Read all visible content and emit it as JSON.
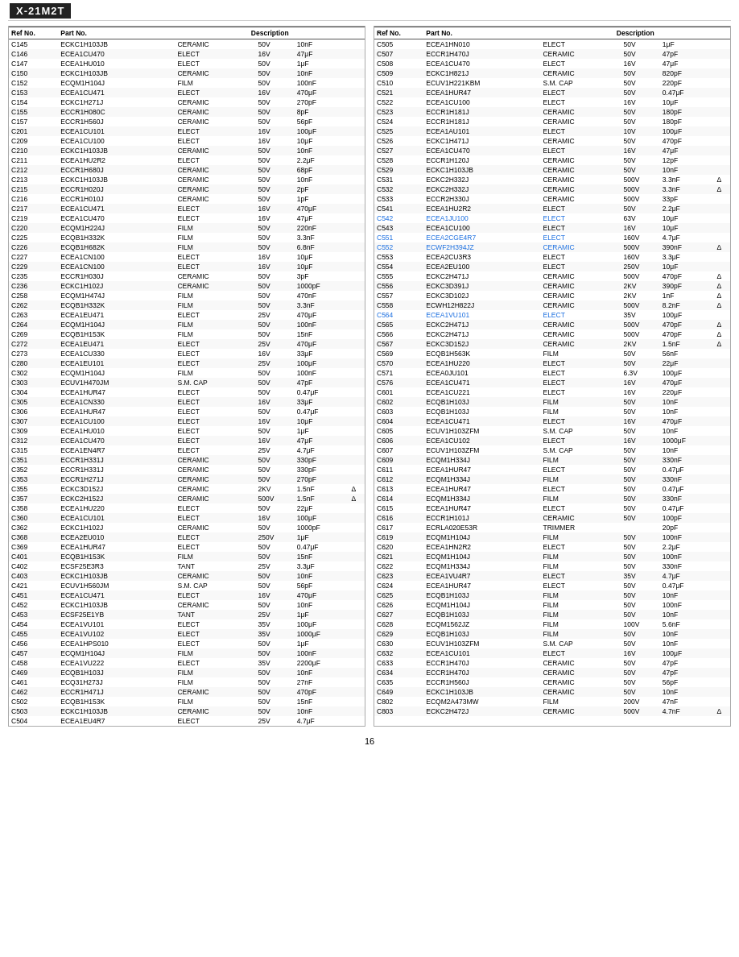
{
  "header": {
    "title": "X-21M2T"
  },
  "footer": {
    "page": "16"
  },
  "left_table": {
    "columns": [
      "Ref No.",
      "Part No.",
      "Description",
      "",
      "",
      ""
    ],
    "rows": [
      [
        "C145",
        "ECKC1H103JB",
        "CERAMIC",
        "50V",
        "10nF",
        ""
      ],
      [
        "C146",
        "ECEA1CU470",
        "ELECT",
        "16V",
        "47μF",
        ""
      ],
      [
        "C147",
        "ECEA1HU010",
        "ELECT",
        "50V",
        "1μF",
        ""
      ],
      [
        "C150",
        "ECKC1H103JB",
        "CERAMIC",
        "50V",
        "10nF",
        ""
      ],
      [
        "C152",
        "ECQM1H104J",
        "FILM",
        "50V",
        "100nF",
        ""
      ],
      [
        "C153",
        "ECEA1CU471",
        "ELECT",
        "16V",
        "470μF",
        ""
      ],
      [
        "C154",
        "ECKC1H271J",
        "CERAMIC",
        "50V",
        "270pF",
        ""
      ],
      [
        "C155",
        "ECCR1H080C",
        "CERAMIC",
        "50V",
        "8pF",
        ""
      ],
      [
        "C157",
        "ECCR1H560J",
        "CERAMIC",
        "50V",
        "56pF",
        ""
      ],
      [
        "C201",
        "ECEA1CU101",
        "ELECT",
        "16V",
        "100μF",
        ""
      ],
      [
        "C209",
        "ECEA1CU100",
        "ELECT",
        "16V",
        "10μF",
        ""
      ],
      [
        "C210",
        "ECKC1H103JB",
        "CERAMIC",
        "50V",
        "10nF",
        ""
      ],
      [
        "C211",
        "ECEA1HU2R2",
        "ELECT",
        "50V",
        "2.2μF",
        ""
      ],
      [
        "C212",
        "ECCR1H680J",
        "CERAMIC",
        "50V",
        "68pF",
        ""
      ],
      [
        "C213",
        "ECKC1H103JB",
        "CERAMIC",
        "50V",
        "10nF",
        ""
      ],
      [
        "C215",
        "ECCR1H020J",
        "CERAMIC",
        "50V",
        "2pF",
        ""
      ],
      [
        "C216",
        "ECCR1H010J",
        "CERAMIC",
        "50V",
        "1pF",
        ""
      ],
      [
        "C217",
        "ECEA1CU471",
        "ELECT",
        "16V",
        "470μF",
        ""
      ],
      [
        "C219",
        "ECEA1CU470",
        "ELECT",
        "16V",
        "47μF",
        ""
      ],
      [
        "C220",
        "ECQM1H224J",
        "FILM",
        "50V",
        "220nF",
        ""
      ],
      [
        "C225",
        "ECQB1H332K",
        "FILM",
        "50V",
        "3.3nF",
        ""
      ],
      [
        "C226",
        "ECQB1H682K",
        "FILM",
        "50V",
        "6.8nF",
        ""
      ],
      [
        "C227",
        "ECEA1CN100",
        "ELECT",
        "16V",
        "10μF",
        ""
      ],
      [
        "C229",
        "ECEA1CN100",
        "ELECT",
        "16V",
        "10μF",
        ""
      ],
      [
        "C235",
        "ECCR1H030J",
        "CERAMIC",
        "50V",
        "3pF",
        ""
      ],
      [
        "C236",
        "ECKC1H102J",
        "CERAMIC",
        "50V",
        "1000pF",
        ""
      ],
      [
        "C258",
        "ECQM1H474J",
        "FILM",
        "50V",
        "470nF",
        ""
      ],
      [
        "C262",
        "ECQB1H332K",
        "FILM",
        "50V",
        "3.3nF",
        ""
      ],
      [
        "C263",
        "ECEA1EU471",
        "ELECT",
        "25V",
        "470μF",
        ""
      ],
      [
        "C264",
        "ECQM1H104J",
        "FILM",
        "50V",
        "100nF",
        ""
      ],
      [
        "C269",
        "ECQB1H153K",
        "FILM",
        "50V",
        "15nF",
        ""
      ],
      [
        "C272",
        "ECEA1EU471",
        "ELECT",
        "25V",
        "470μF",
        ""
      ],
      [
        "C273",
        "ECEA1CU330",
        "ELECT",
        "16V",
        "33μF",
        ""
      ],
      [
        "C280",
        "ECEA1EU101",
        "ELECT",
        "25V",
        "100μF",
        ""
      ],
      [
        "C302",
        "ECQM1H104J",
        "FILM",
        "50V",
        "100nF",
        ""
      ],
      [
        "C303",
        "ECUV1H470JM",
        "S.M. CAP",
        "50V",
        "47pF",
        ""
      ],
      [
        "C304",
        "ECEA1HUR47",
        "ELECT",
        "50V",
        "0.47μF",
        ""
      ],
      [
        "C305",
        "ECEA1CN330",
        "ELECT",
        "16V",
        "33μF",
        ""
      ],
      [
        "C306",
        "ECEA1HUR47",
        "ELECT",
        "50V",
        "0.47μF",
        ""
      ],
      [
        "C307",
        "ECEA1CU100",
        "ELECT",
        "16V",
        "10μF",
        ""
      ],
      [
        "C309",
        "ECEA1HU010",
        "ELECT",
        "50V",
        "1μF",
        ""
      ],
      [
        "C312",
        "ECEA1CU470",
        "ELECT",
        "16V",
        "47μF",
        ""
      ],
      [
        "C315",
        "ECEA1EN4R7",
        "ELECT",
        "25V",
        "4.7μF",
        ""
      ],
      [
        "C351",
        "ECCR1H331J",
        "CERAMIC",
        "50V",
        "330pF",
        ""
      ],
      [
        "C352",
        "ECCR1H331J",
        "CERAMIC",
        "50V",
        "330pF",
        ""
      ],
      [
        "C353",
        "ECCR1H271J",
        "CERAMIC",
        "50V",
        "270pF",
        ""
      ],
      [
        "C355",
        "ECKC3D152J",
        "CERAMIC",
        "2KV",
        "1.5nF",
        "Δ"
      ],
      [
        "C357",
        "ECKC2H152J",
        "CERAMIC",
        "500V",
        "1.5nF",
        "Δ"
      ],
      [
        "C358",
        "ECEA1HU220",
        "ELECT",
        "50V",
        "22μF",
        ""
      ],
      [
        "C360",
        "ECEA1CU101",
        "ELECT",
        "16V",
        "100μF",
        ""
      ],
      [
        "C362",
        "ECKC1H102J",
        "CERAMIC",
        "50V",
        "1000pF",
        ""
      ],
      [
        "C368",
        "ECEA2EU010",
        "ELECT",
        "250V",
        "1μF",
        ""
      ],
      [
        "C369",
        "ECEA1HUR47",
        "ELECT",
        "50V",
        "0.47μF",
        ""
      ],
      [
        "C401",
        "ECQB1H153K",
        "FILM",
        "50V",
        "15nF",
        ""
      ],
      [
        "C402",
        "ECSF25E3R3",
        "TANT",
        "25V",
        "3.3μF",
        ""
      ],
      [
        "C403",
        "ECKC1H103JB",
        "CERAMIC",
        "50V",
        "10nF",
        ""
      ],
      [
        "C421",
        "ECUV1H560JM",
        "S.M. CAP",
        "50V",
        "56pF",
        ""
      ],
      [
        "C451",
        "ECEA1CU471",
        "ELECT",
        "16V",
        "470μF",
        ""
      ],
      [
        "C452",
        "ECKC1H103JB",
        "CERAMIC",
        "50V",
        "10nF",
        ""
      ],
      [
        "C453",
        "ECSF25E1YB",
        "TANT",
        "25V",
        "1μF",
        ""
      ],
      [
        "C454",
        "ECEA1VU101",
        "ELECT",
        "35V",
        "100μF",
        ""
      ],
      [
        "C455",
        "ECEA1VU102",
        "ELECT",
        "35V",
        "1000μF",
        ""
      ],
      [
        "C456",
        "ECEA1HPS010",
        "ELECT",
        "50V",
        "1μF",
        ""
      ],
      [
        "C457",
        "ECQM1H104J",
        "FILM",
        "50V",
        "100nF",
        ""
      ],
      [
        "C458",
        "ECEA1VU222",
        "ELECT",
        "35V",
        "2200μF",
        ""
      ],
      [
        "C469",
        "ECQB1H103J",
        "FILM",
        "50V",
        "10nF",
        ""
      ],
      [
        "C461",
        "ECQ31H273J",
        "FILM",
        "50V",
        "27nF",
        ""
      ],
      [
        "C462",
        "ECCR1H471J",
        "CERAMIC",
        "50V",
        "470pF",
        ""
      ],
      [
        "C502",
        "ECQB1H153K",
        "FILM",
        "50V",
        "15nF",
        ""
      ],
      [
        "C503",
        "ECKC1H103JB",
        "CERAMIC",
        "50V",
        "10nF",
        ""
      ],
      [
        "C504",
        "ECEA1EU4R7",
        "ELECT",
        "25V",
        "4.7μF",
        ""
      ]
    ]
  },
  "right_table": {
    "columns": [
      "Ref No.",
      "Part No.",
      "Description",
      "",
      "",
      ""
    ],
    "rows": [
      [
        "C505",
        "ECEA1HN010",
        "ELECT",
        "50V",
        "1μF",
        ""
      ],
      [
        "C507",
        "ECCR1H470J",
        "CERAMIC",
        "50V",
        "47pF",
        ""
      ],
      [
        "C508",
        "ECEA1CU470",
        "ELECT",
        "16V",
        "47μF",
        ""
      ],
      [
        "C509",
        "ECKC1H821J",
        "CERAMIC",
        "50V",
        "820pF",
        ""
      ],
      [
        "C510",
        "ECUV1H221KBM",
        "S.M. CAP",
        "50V",
        "220pF",
        ""
      ],
      [
        "C521",
        "ECEA1HUR47",
        "ELECT",
        "50V",
        "0.47μF",
        ""
      ],
      [
        "C522",
        "ECEA1CU100",
        "ELECT",
        "16V",
        "10μF",
        ""
      ],
      [
        "C523",
        "ECCR1H181J",
        "CERAMIC",
        "50V",
        "180pF",
        ""
      ],
      [
        "C524",
        "ECCR1H181J",
        "CERAMIC",
        "50V",
        "180pF",
        ""
      ],
      [
        "C525",
        "ECEA1AU101",
        "ELECT",
        "10V",
        "100μF",
        ""
      ],
      [
        "C526",
        "ECKC1H471J",
        "CERAMIC",
        "50V",
        "470pF",
        ""
      ],
      [
        "C527",
        "ECEA1CU470",
        "ELECT",
        "16V",
        "47μF",
        ""
      ],
      [
        "C528",
        "ECCR1H120J",
        "CERAMIC",
        "50V",
        "12pF",
        ""
      ],
      [
        "C529",
        "ECKC1H103JB",
        "CERAMIC",
        "50V",
        "10nF",
        ""
      ],
      [
        "C531",
        "ECKC2H332J",
        "CERAMIC",
        "500V",
        "3.3nF",
        "Δ"
      ],
      [
        "C532",
        "ECKC2H332J",
        "CERAMIC",
        "500V",
        "3.3nF",
        "Δ"
      ],
      [
        "C533",
        "ECCR2H330J",
        "CERAMIC",
        "500V",
        "33pF",
        ""
      ],
      [
        "C541",
        "ECEA1HU2R2",
        "ELECT",
        "50V",
        "2.2μF",
        ""
      ],
      [
        "C542",
        "ECEA1JU100",
        "ELECT",
        "63V",
        "10μF",
        ""
      ],
      [
        "C543",
        "ECEA1CU100",
        "ELECT",
        "16V",
        "10μF",
        ""
      ],
      [
        "C551",
        "ECEA2CGE4R7",
        "ELECT",
        "160V",
        "4.7μF",
        ""
      ],
      [
        "C552",
        "ECWF2H394JZ",
        "CERAMIC",
        "500V",
        "390nF",
        "Δ"
      ],
      [
        "C553",
        "ECEA2CU3R3",
        "ELECT",
        "160V",
        "3.3μF",
        ""
      ],
      [
        "C554",
        "ECEA2EU100",
        "ELECT",
        "250V",
        "10μF",
        ""
      ],
      [
        "C555",
        "ECKC2H471J",
        "CERAMIC",
        "500V",
        "470pF",
        "Δ"
      ],
      [
        "C556",
        "ECKC3D391J",
        "CERAMIC",
        "2KV",
        "390pF",
        "Δ"
      ],
      [
        "C557",
        "ECKC3D102J",
        "CERAMIC",
        "2KV",
        "1nF",
        "Δ"
      ],
      [
        "C558",
        "ECWH12H822J",
        "CERAMIC",
        "500V",
        "8.2nF",
        "Δ"
      ],
      [
        "C564",
        "ECEA1VU101",
        "ELECT",
        "35V",
        "100μF",
        ""
      ],
      [
        "C565",
        "ECKC2H471J",
        "CERAMIC",
        "500V",
        "470pF",
        "Δ"
      ],
      [
        "C566",
        "ECKC2H471J",
        "CERAMIC",
        "500V",
        "470pF",
        "Δ"
      ],
      [
        "C567",
        "ECKC3D152J",
        "CERAMIC",
        "2KV",
        "1.5nF",
        "Δ"
      ],
      [
        "C569",
        "ECQB1H563K",
        "FILM",
        "50V",
        "56nF",
        ""
      ],
      [
        "C570",
        "ECEA1HU220",
        "ELECT",
        "50V",
        "22μF",
        ""
      ],
      [
        "C571",
        "ECEA0JU101",
        "ELECT",
        "6.3V",
        "100μF",
        ""
      ],
      [
        "C576",
        "ECEA1CU471",
        "ELECT",
        "16V",
        "470μF",
        ""
      ],
      [
        "C601",
        "ECEA1CU221",
        "ELECT",
        "16V",
        "220μF",
        ""
      ],
      [
        "C602",
        "ECQB1H103J",
        "FILM",
        "50V",
        "10nF",
        ""
      ],
      [
        "C603",
        "ECQB1H103J",
        "FILM",
        "50V",
        "10nF",
        ""
      ],
      [
        "C604",
        "ECEA1CU471",
        "ELECT",
        "16V",
        "470μF",
        ""
      ],
      [
        "C605",
        "ECUV1H103ZFM",
        "S.M. CAP",
        "50V",
        "10nF",
        ""
      ],
      [
        "C606",
        "ECEA1CU102",
        "ELECT",
        "16V",
        "1000μF",
        ""
      ],
      [
        "C607",
        "ECUV1H103ZFM",
        "S.M. CAP",
        "50V",
        "10nF",
        ""
      ],
      [
        "C609",
        "ECQM1H334J",
        "FILM",
        "50V",
        "330nF",
        ""
      ],
      [
        "C611",
        "ECEA1HUR47",
        "ELECT",
        "50V",
        "0.47μF",
        ""
      ],
      [
        "C612",
        "ECQM1H334J",
        "FILM",
        "50V",
        "330nF",
        ""
      ],
      [
        "C613",
        "ECEA1HUR47",
        "ELECT",
        "50V",
        "0.47μF",
        ""
      ],
      [
        "C614",
        "ECQM1H334J",
        "FILM",
        "50V",
        "330nF",
        ""
      ],
      [
        "C615",
        "ECEA1HUR47",
        "ELECT",
        "50V",
        "0.47μF",
        ""
      ],
      [
        "C616",
        "ECCR1H101J",
        "CERAMIC",
        "50V",
        "100pF",
        ""
      ],
      [
        "C617",
        "ECRLA020E53R",
        "TRIMMER",
        "",
        "20pF",
        ""
      ],
      [
        "C619",
        "ECQM1H104J",
        "FILM",
        "50V",
        "100nF",
        ""
      ],
      [
        "C620",
        "ECEA1HN2R2",
        "ELECT",
        "50V",
        "2.2μF",
        ""
      ],
      [
        "C621",
        "ECQM1H104J",
        "FILM",
        "50V",
        "100nF",
        ""
      ],
      [
        "C622",
        "ECQM1H334J",
        "FILM",
        "50V",
        "330nF",
        ""
      ],
      [
        "C623",
        "ECEA1VU4R7",
        "ELECT",
        "35V",
        "4.7μF",
        ""
      ],
      [
        "C624",
        "ECEA1HUR47",
        "ELECT",
        "50V",
        "0.47μF",
        ""
      ],
      [
        "C625",
        "ECQB1H103J",
        "FILM",
        "50V",
        "10nF",
        ""
      ],
      [
        "C626",
        "ECQM1H104J",
        "FILM",
        "50V",
        "100nF",
        ""
      ],
      [
        "C627",
        "ECQB1H103J",
        "FILM",
        "50V",
        "10nF",
        ""
      ],
      [
        "C628",
        "ECQM1562JZ",
        "FILM",
        "100V",
        "5.6nF",
        ""
      ],
      [
        "C629",
        "ECQB1H103J",
        "FILM",
        "50V",
        "10nF",
        ""
      ],
      [
        "C630",
        "ECUV1H103ZFM",
        "S.M. CAP",
        "50V",
        "10nF",
        ""
      ],
      [
        "C632",
        "ECEA1CU101",
        "ELECT",
        "16V",
        "100μF",
        ""
      ],
      [
        "C633",
        "ECCR1H470J",
        "CERAMIC",
        "50V",
        "47pF",
        ""
      ],
      [
        "C634",
        "ECCR1H470J",
        "CERAMIC",
        "50V",
        "47pF",
        ""
      ],
      [
        "C635",
        "ECCR1H560J",
        "CERAMIC",
        "50V",
        "56pF",
        ""
      ],
      [
        "C649",
        "ECKC1H103JB",
        "CERAMIC",
        "50V",
        "10nF",
        ""
      ],
      [
        "C802",
        "ECQM2A473MW",
        "FILM",
        "200V",
        "47nF",
        ""
      ],
      [
        "C803",
        "ECKC2H472J",
        "CERAMIC",
        "500V",
        "4.7nF",
        "Δ"
      ]
    ]
  }
}
